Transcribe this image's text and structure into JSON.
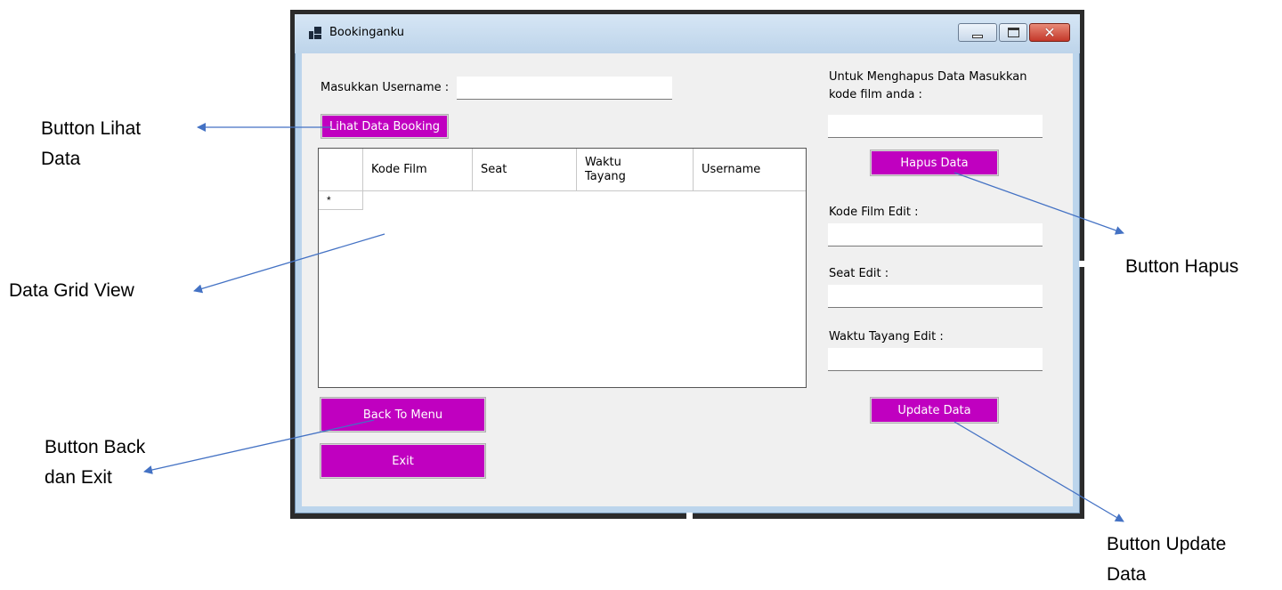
{
  "annotations": {
    "lihat": [
      "Button Lihat",
      "Data"
    ],
    "grid": "Data Grid View",
    "back_exit": [
      "Button Back",
      "dan Exit"
    ],
    "hapus": "Button Hapus",
    "update": [
      "Button Update",
      "Data"
    ]
  },
  "window": {
    "title": "Bookinganku"
  },
  "form": {
    "username_label": "Masukkan Username :",
    "username_value": "",
    "lihat_button": "Lihat Data Booking",
    "grid": {
      "columns": [
        "Kode Film",
        "Seat",
        "Waktu Tayang",
        "Username"
      ],
      "new_row_marker": "*"
    },
    "back_button": "Back To Menu",
    "exit_button": "Exit",
    "hapus_label": "Untuk Menghapus Data Masukkan kode film anda :",
    "hapus_value": "",
    "hapus_button": "Hapus Data",
    "kode_edit_label": "Kode Film Edit :",
    "kode_edit_value": "",
    "seat_edit_label": "Seat Edit :",
    "seat_edit_value": "",
    "waktu_edit_label": "Waktu Tayang Edit :",
    "waktu_edit_value": "",
    "update_button": "Update Data"
  },
  "colors": {
    "button_bg": "#c000c0",
    "annotation_arrow": "#4472c4"
  },
  "icons": [
    "app-icon",
    "minimize-icon",
    "maximize-icon",
    "close-icon"
  ]
}
